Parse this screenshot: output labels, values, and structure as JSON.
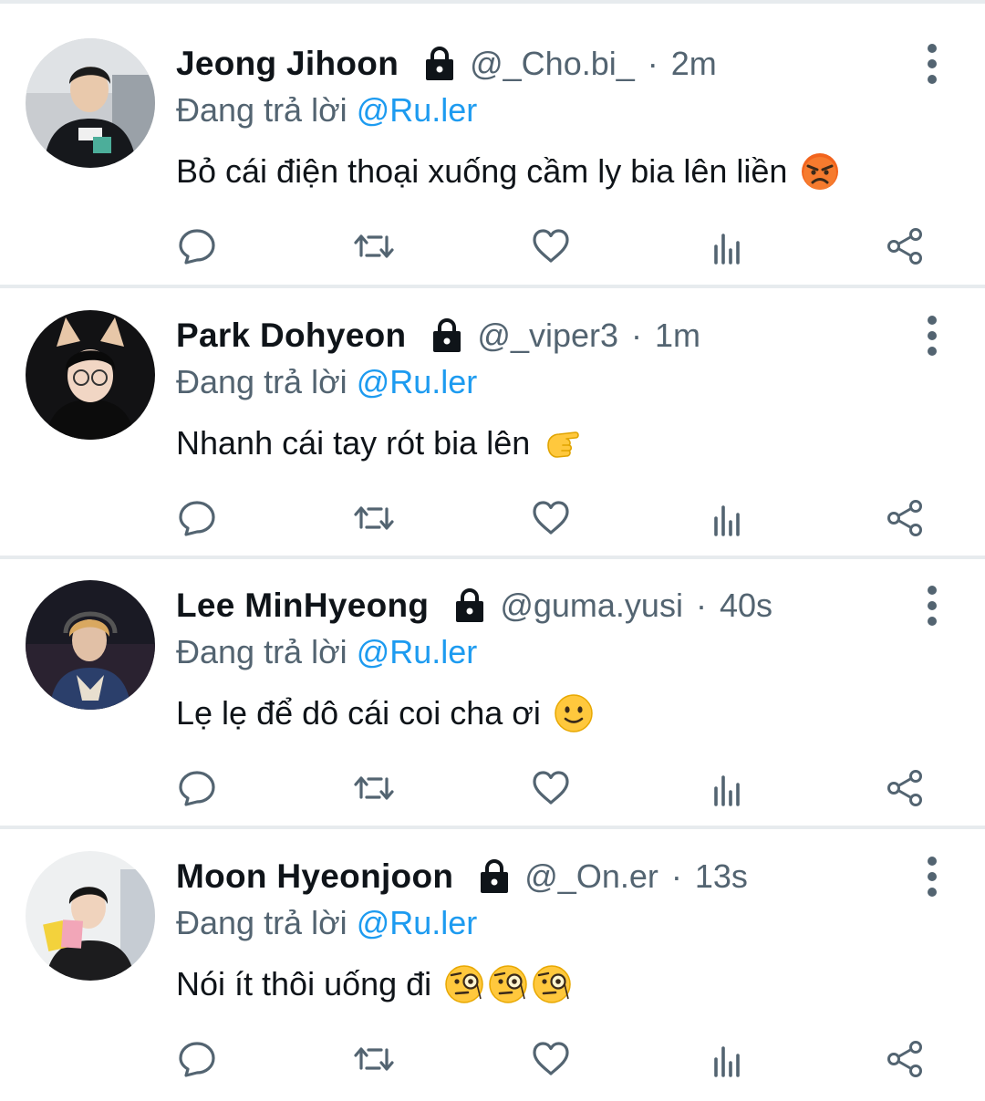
{
  "feed": {
    "reply_prefix": "Đang trả lời",
    "separator": "·",
    "tweets": [
      {
        "name": "Jeong Jihoon",
        "handle": "@_Cho.bi_",
        "time": "2m",
        "reply_to": "@Ru.ler",
        "text": "Bỏ cái điện thoại xuống cầm ly bia lên liền",
        "emoji": [
          "angry-face"
        ]
      },
      {
        "name": "Park Dohyeon",
        "handle": "@_viper3",
        "time": "1m",
        "reply_to": "@Ru.ler",
        "text": "Nhanh cái tay rót bia lên",
        "emoji": [
          "pointing-hand"
        ]
      },
      {
        "name": "Lee MinHyeong",
        "handle": "@guma.yusi",
        "time": "40s",
        "reply_to": "@Ru.ler",
        "text": "Lẹ lẹ để dô cái coi cha ơi",
        "emoji": [
          "slight-smile"
        ]
      },
      {
        "name": "Moon Hyeonjoon",
        "handle": "@_On.er",
        "time": "13s",
        "reply_to": "@Ru.ler",
        "text": "Nói ít thôi uống đi",
        "emoji": [
          "monocle-face",
          "monocle-face",
          "monocle-face"
        ]
      }
    ]
  },
  "icons": {
    "lock": "lock-icon",
    "more": "more-vertical-icon",
    "reply": "reply-icon",
    "retweet": "retweet-icon",
    "like": "heart-icon",
    "views": "views-icon",
    "share": "share-icon"
  },
  "colors": {
    "text": "#0f1419",
    "secondary": "#536471",
    "mention": "#1d9bf0",
    "divider": "#e7ebee",
    "emoji_yellow": "#ffc83d",
    "emoji_angry": "#f2641d"
  }
}
